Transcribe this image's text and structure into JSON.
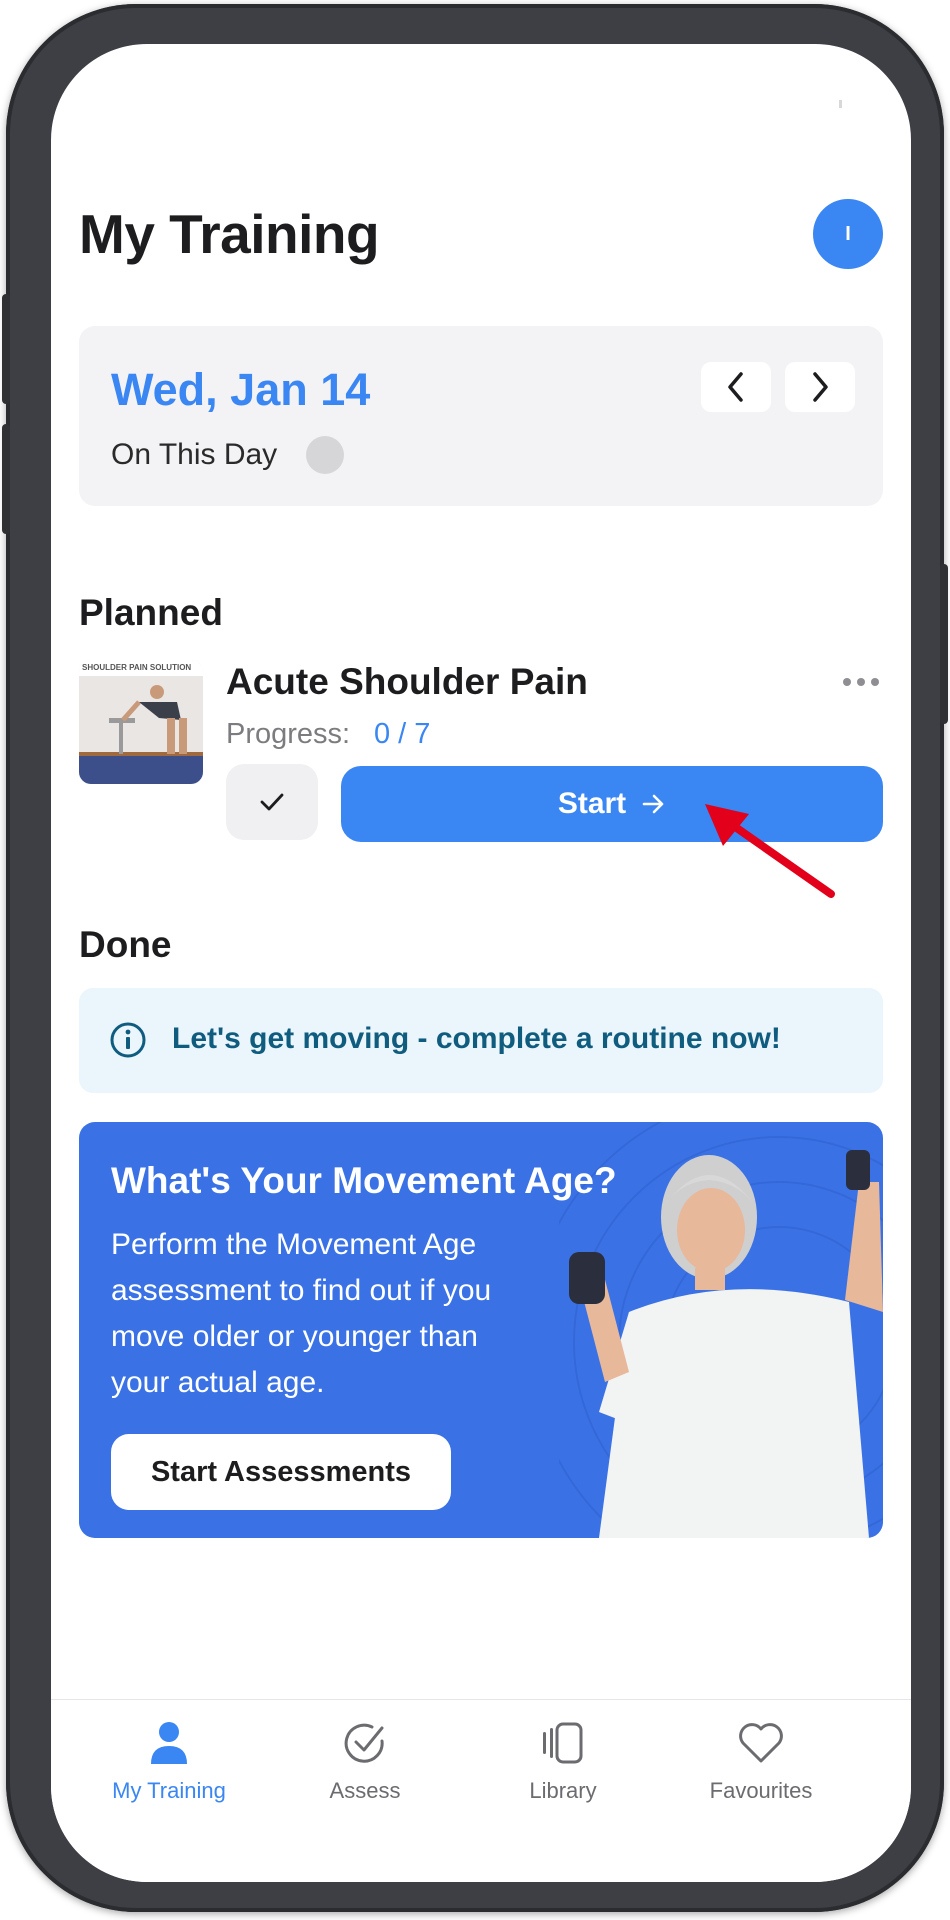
{
  "header": {
    "title": "My Training",
    "avatar_initial": "I"
  },
  "date_card": {
    "date": "Wed, Jan 14",
    "on_this_day_label": "On This Day"
  },
  "planned": {
    "heading": "Planned",
    "item": {
      "thumbnail_caption": "SHOULDER PAIN SOLUTION",
      "title": "Acute Shoulder Pain",
      "progress_label": "Progress:",
      "progress_value": "0 / 7",
      "start_label": "Start"
    }
  },
  "done": {
    "heading": "Done",
    "info_message": "Let's get moving - complete a routine now!"
  },
  "promo": {
    "title": "What's Your Movement Age?",
    "body": "Perform the Movement Age assessment to find out if you move older or younger than your actual age.",
    "button_label": "Start Assessments"
  },
  "tabbar": {
    "items": [
      {
        "label": "My Training",
        "icon": "person-icon",
        "active": true
      },
      {
        "label": "Assess",
        "icon": "check-circle-icon",
        "active": false
      },
      {
        "label": "Library",
        "icon": "library-icon",
        "active": false
      },
      {
        "label": "Favourites",
        "icon": "heart-icon",
        "active": false
      }
    ]
  },
  "colors": {
    "accent": "#3a86f2",
    "promo_bg": "#3a72e6",
    "info_bg": "#eaf5fc",
    "info_text": "#0f5c7e",
    "annotation_arrow": "#e3001b",
    "frame": "#3e3f44"
  }
}
